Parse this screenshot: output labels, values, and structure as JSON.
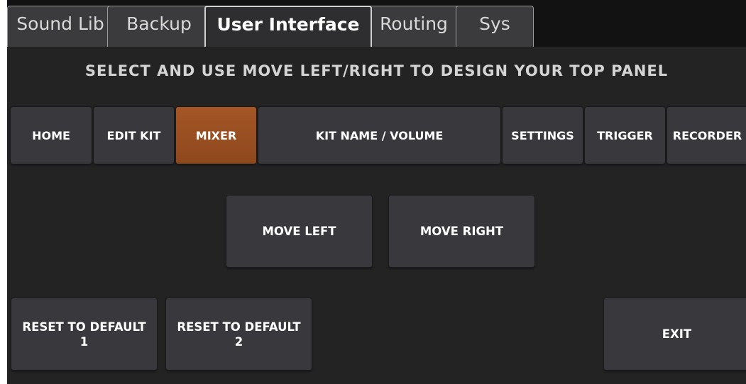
{
  "tabs": [
    {
      "label": "Sound Lib",
      "active": false
    },
    {
      "label": "Backup",
      "active": false
    },
    {
      "label": "User Interface",
      "active": true
    },
    {
      "label": "Routing",
      "active": false
    },
    {
      "label": "Sys",
      "active": false
    }
  ],
  "heading": "SELECT AND USE MOVE LEFT/RIGHT TO DESIGN YOUR TOP PANEL",
  "panel_buttons": [
    {
      "label": "HOME",
      "selected": false
    },
    {
      "label": "EDIT KIT",
      "selected": false
    },
    {
      "label": "MIXER",
      "selected": true
    },
    {
      "label": "KIT NAME / VOLUME",
      "selected": false
    },
    {
      "label": "SETTINGS",
      "selected": false
    },
    {
      "label": "TRIGGER",
      "selected": false
    },
    {
      "label": "RECORDER",
      "selected": false
    }
  ],
  "move_buttons": {
    "left": "MOVE LEFT",
    "right": "MOVE RIGHT"
  },
  "reset_buttons": {
    "default1_line1": "RESET TO DEFAULT",
    "default1_line2": "1",
    "default2_line1": "RESET TO DEFAULT",
    "default2_line2": "2"
  },
  "exit_label": "EXIT",
  "colors": {
    "background": "#232324",
    "button": "#39393d",
    "selected": "#9b4f22",
    "text": "#ffffff"
  }
}
